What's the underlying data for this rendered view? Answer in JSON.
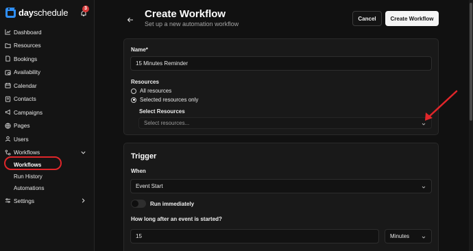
{
  "brand": {
    "name_bold": "day",
    "name_light": "schedule",
    "notification_count": "3"
  },
  "sidebar": {
    "items": [
      {
        "label": "Dashboard",
        "icon": "chart-icon"
      },
      {
        "label": "Resources",
        "icon": "folder-icon"
      },
      {
        "label": "Bookings",
        "icon": "document-icon"
      },
      {
        "label": "Availability",
        "icon": "calendar-clock-icon"
      },
      {
        "label": "Calendar",
        "icon": "calendar-icon"
      },
      {
        "label": "Contacts",
        "icon": "contacts-icon"
      },
      {
        "label": "Campaigns",
        "icon": "megaphone-icon"
      },
      {
        "label": "Pages",
        "icon": "globe-icon"
      },
      {
        "label": "Users",
        "icon": "user-icon"
      },
      {
        "label": "Workflows",
        "icon": "workflow-icon"
      }
    ],
    "sub_items": [
      "Workflows",
      "Run History",
      "Automations"
    ],
    "settings": {
      "label": "Settings",
      "icon": "sliders-icon"
    }
  },
  "header": {
    "title": "Create Workflow",
    "subtitle": "Set up a new automation workflow",
    "cancel_label": "Cancel",
    "create_label": "Create Workflow"
  },
  "form": {
    "name_label": "Name*",
    "name_value": "15 Minutes Reminder",
    "resources_label": "Resources",
    "radio_all": "All resources",
    "radio_selected": "Selected resources only",
    "select_resources_label": "Select Resources",
    "select_resources_placeholder": "Select resources..."
  },
  "trigger": {
    "title": "Trigger",
    "when_label": "When",
    "when_value": "Event Start",
    "toggle_label": "Run immediately",
    "delay_label": "How long after an event is started?",
    "delay_value": "15",
    "unit_value": "Minutes"
  },
  "colors": {
    "accent": "#2f8ff7",
    "annotation": "#e0262a",
    "badge": "#d63a3a"
  }
}
